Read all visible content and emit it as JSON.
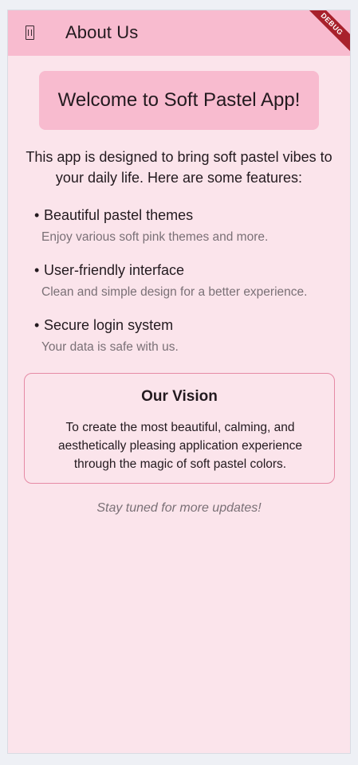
{
  "appbar": {
    "title": "About Us",
    "nav_icon": "hourglass-icon",
    "debug_label": "DEBUG"
  },
  "welcome": {
    "title": "Welcome to Soft Pastel App!"
  },
  "intro": {
    "text": "This app is designed to bring soft pastel vibes to your daily life. Here are some features:"
  },
  "features": [
    {
      "bullet": "•",
      "title": "Beautiful pastel themes",
      "description": "Enjoy various soft pink themes and more."
    },
    {
      "bullet": "•",
      "title": "User-friendly interface",
      "description": "Clean and simple design for a better experience."
    },
    {
      "bullet": "•",
      "title": "Secure login system",
      "description": "Your data is safe with us."
    }
  ],
  "vision": {
    "title": "Our Vision",
    "text": "To create the most beautiful, calming, and aesthetically pleasing application experience through the magic of soft pastel colors."
  },
  "footer": {
    "note": "Stay tuned for more updates!"
  },
  "colors": {
    "appbar": "#f8bbcf",
    "background": "#fbe4eb",
    "accent_border": "#e68aa5",
    "debug": "#a8212c"
  }
}
